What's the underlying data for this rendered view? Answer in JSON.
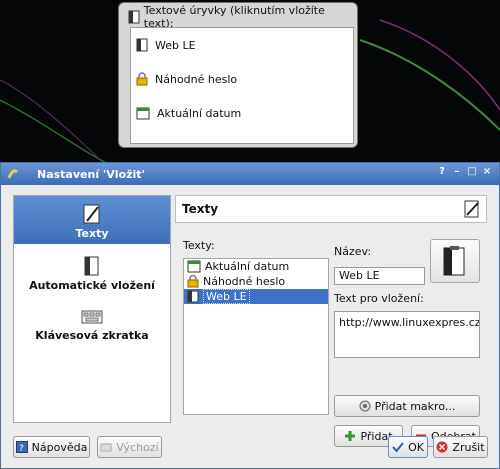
{
  "popup": {
    "title": "Textové úryvky (kliknutím vložíte text):",
    "items": [
      {
        "label": "Web LE",
        "icon": "note-icon"
      },
      {
        "label": "Náhodné heslo",
        "icon": "lock-icon"
      },
      {
        "label": "Aktuální datum",
        "icon": "calendar-icon"
      }
    ]
  },
  "dialog": {
    "title": "Nastavení 'Vložit'",
    "window_buttons": [
      "?",
      "–",
      "□",
      "×"
    ],
    "sidebar": [
      {
        "label": "Texty",
        "icon": "pen-icon"
      },
      {
        "label": "Automatické vložení",
        "icon": "clipboard-icon"
      },
      {
        "label": "Klávesová zkratka",
        "icon": "keyboard-icon"
      }
    ],
    "section_title": "Texty",
    "texts_label": "Texty:",
    "texts": [
      {
        "label": "Aktuální datum",
        "icon": "calendar-icon"
      },
      {
        "label": "Náhodné heslo",
        "icon": "lock-icon"
      },
      {
        "label": "Web LE",
        "icon": "note-icon"
      }
    ],
    "name_label": "Název:",
    "name_value": "Web LE",
    "text_label": "Text pro vložení:",
    "text_value": "http://www.linuxexpres.cz",
    "add_macro": "Přidat makro...",
    "add": "Přidat",
    "remove": "Odebrat",
    "help": "Nápověda",
    "defaults": "Výchozí",
    "ok": "OK",
    "cancel": "Zrušit"
  },
  "colors": {
    "selection": "#3e72c6",
    "titlebar": "#3a6bb2",
    "add_green": "#2e9a2e",
    "remove_red": "#d42b2b"
  }
}
